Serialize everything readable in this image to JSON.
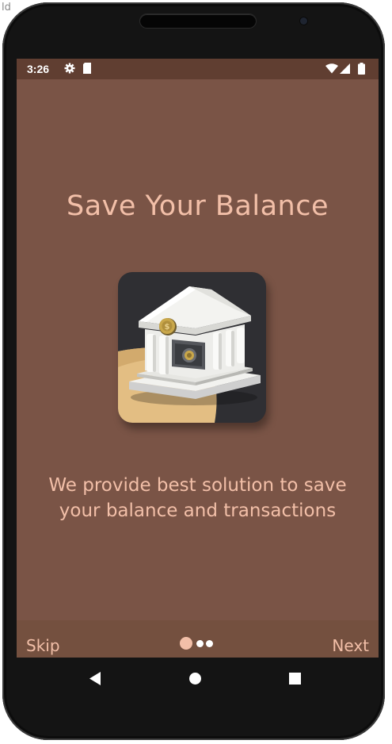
{
  "corner_text": "ld",
  "status_bar": {
    "time": "3:26",
    "icons": [
      "gear-icon",
      "sim-card-icon",
      "wifi-icon",
      "cell-signal-icon",
      "battery-icon"
    ]
  },
  "onboarding": {
    "title": "Save Your Balance",
    "illustration": "bank-building-icon",
    "description_line1": "We provide best solution to save",
    "description_line2": "your balance and transactions",
    "pages_total": 3,
    "current_page": 1
  },
  "bottom_bar": {
    "skip_label": "Skip",
    "next_label": "Next"
  },
  "nav_bar": {
    "icons": [
      "back-icon",
      "home-icon",
      "recents-icon"
    ]
  },
  "colors": {
    "screen_background": "#7a5446",
    "status_bar": "#603e31",
    "accent_text": "#f2bfa8",
    "illustration_background": "#2f2f33",
    "illustration_sand": "#e3be83"
  }
}
